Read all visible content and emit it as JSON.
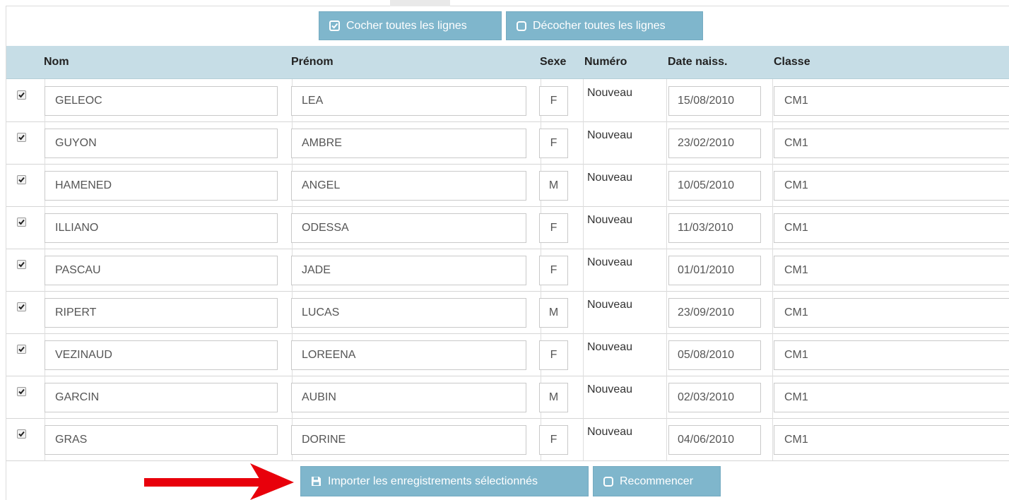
{
  "toolbar": {
    "check_all_label": "Cocher toutes les lignes",
    "uncheck_all_label": "Décocher toutes les lignes"
  },
  "table": {
    "columns": [
      "Nom",
      "Prénom",
      "Sexe",
      "Numéro",
      "Date naiss.",
      "Classe"
    ],
    "rows": [
      {
        "checked": true,
        "nom": "GELEOC",
        "prenom": "LEA",
        "sexe": "F",
        "numero": "Nouveau",
        "date": "15/08/2010",
        "classe": "CM1"
      },
      {
        "checked": true,
        "nom": "GUYON",
        "prenom": "AMBRE",
        "sexe": "F",
        "numero": "Nouveau",
        "date": "23/02/2010",
        "classe": "CM1"
      },
      {
        "checked": true,
        "nom": "HAMENED",
        "prenom": "ANGEL",
        "sexe": "M",
        "numero": "Nouveau",
        "date": "10/05/2010",
        "classe": "CM1"
      },
      {
        "checked": true,
        "nom": "ILLIANO",
        "prenom": "ODESSA",
        "sexe": "F",
        "numero": "Nouveau",
        "date": "11/03/2010",
        "classe": "CM1"
      },
      {
        "checked": true,
        "nom": "PASCAU",
        "prenom": "JADE",
        "sexe": "F",
        "numero": "Nouveau",
        "date": "01/01/2010",
        "classe": "CM1"
      },
      {
        "checked": true,
        "nom": "RIPERT",
        "prenom": "LUCAS",
        "sexe": "M",
        "numero": "Nouveau",
        "date": "23/09/2010",
        "classe": "CM1"
      },
      {
        "checked": true,
        "nom": "VEZINAUD",
        "prenom": "LOREENA",
        "sexe": "F",
        "numero": "Nouveau",
        "date": "05/08/2010",
        "classe": "CM1"
      },
      {
        "checked": true,
        "nom": "GARCIN",
        "prenom": "AUBIN",
        "sexe": "M",
        "numero": "Nouveau",
        "date": "02/03/2010",
        "classe": "CM1"
      },
      {
        "checked": true,
        "nom": "GRAS",
        "prenom": "DORINE",
        "sexe": "F",
        "numero": "Nouveau",
        "date": "04/06/2010",
        "classe": "CM1"
      }
    ]
  },
  "footer": {
    "import_label": "Importer les enregistrements sélectionnés",
    "restart_label": "Recommencer"
  },
  "colors": {
    "button_bg": "#7fb6cc",
    "header_bg": "#c6dde6",
    "arrow": "#e8000b"
  },
  "icons": {
    "check_all": "check-square-icon",
    "uncheck_all": "square-icon",
    "import": "floppy-disk-icon",
    "restart": "square-icon",
    "annotation": "red-arrow-icon"
  }
}
